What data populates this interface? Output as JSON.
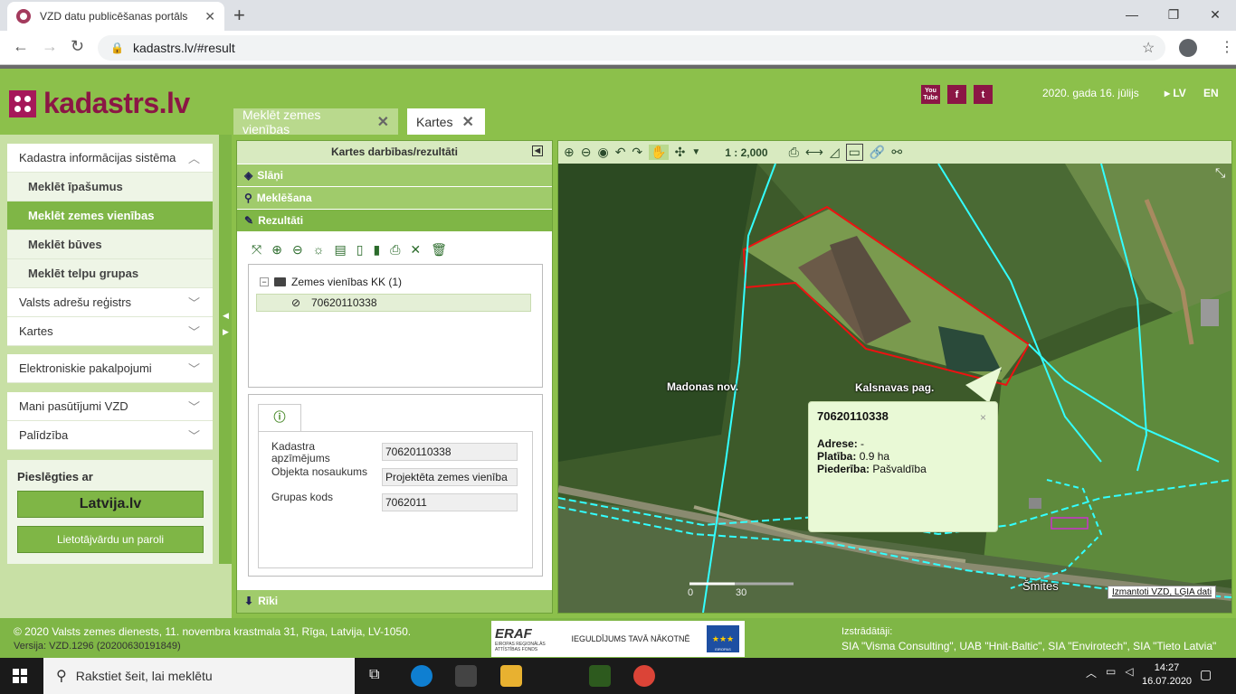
{
  "browser": {
    "tab_title": "VZD datu publicēšanas portāls",
    "close": "✕",
    "new_tab": "+",
    "url": "kadastrs.lv/#result"
  },
  "header": {
    "logo_text": "kadastrs.lv",
    "social": [
      "You Tube",
      "f",
      "t"
    ],
    "date": "2020. gada 16. jūlijs",
    "lang_lv": "LV",
    "lang_en": "EN"
  },
  "tabs": [
    {
      "label": "Meklēt zemes vienības",
      "close": "✕"
    },
    {
      "label": "Kartes",
      "close": "✕"
    }
  ],
  "sidebar": {
    "kis_label": "Kadastra informācijas sistēma",
    "subitems": [
      "Meklēt īpašumus",
      "Meklēt zemes vienības",
      "Meklēt būves",
      "Meklēt telpu grupas"
    ],
    "items": [
      "Valsts adrešu reģistrs",
      "Kartes"
    ],
    "eservices": "Elektroniskie pakalpojumi",
    "orders": "Mani pasūtījumi VZD",
    "help": "Palīdzība",
    "login_label": "Pieslēgties ar",
    "latvija_btn": "Latvija.lv",
    "pass_btn": "Lietotājvārdu un paroli"
  },
  "panel": {
    "title": "Kartes darbības/rezultāti",
    "acc_layers": "Slāņi",
    "acc_search": "Meklēšana",
    "acc_results": "Rezultāti",
    "tree_group": "Zemes vienības KK (1)",
    "tree_item": "70620110338",
    "fields": [
      {
        "label": "Kadastra apzīmējums",
        "value": "70620110338"
      },
      {
        "label": "Objekta nosaukums",
        "value": "Projektēta zemes vienība"
      },
      {
        "label": "Grupas kods",
        "value": "7062011"
      }
    ],
    "tools": "Rīki"
  },
  "map": {
    "scale": "1 : 2,000",
    "label_nov": "Madonas nov.",
    "label_pag": "Kalsnavas pag.",
    "label_place": "Šmites",
    "scalebar_0": "0",
    "scalebar_30": "30",
    "credit": "Izmantoti VZD, LĢIA dati",
    "popup": {
      "title": "70620110338",
      "close": "×",
      "adrese_label": "Adrese:",
      "adrese": "-",
      "platiba_label": "Platība:",
      "platiba": "0.9 ha",
      "piederiba_label": "Piederība:",
      "piederiba": "Pašvaldība"
    }
  },
  "footer": {
    "copyright": "© 2020 Valsts zemes dienests, 11. novembra krastmala 31, Rīga, Latvija, LV-1050.",
    "version": "Versija: VZD.1296 (20200630191849)",
    "eraf": "ERAF",
    "eraf_sub": "EIROPAS REĢIONĀLĀS ATTĪSTĪBAS FONDS",
    "slogan": "IEGULDĪJUMS TAVĀ NĀKOTNĒ",
    "eu_sub": "EIROPAS SAVIENĪBA",
    "dev_label": "Izstrādātāji:",
    "developers": "SIA \"Visma Consulting\", UAB \"Hnit-Baltic\", SIA \"Envirotech\", SIA \"Tieto Latvia\""
  },
  "taskbar": {
    "search": "Rakstiet šeit, lai meklētu",
    "time": "14:27",
    "date": "16.07.2020"
  }
}
